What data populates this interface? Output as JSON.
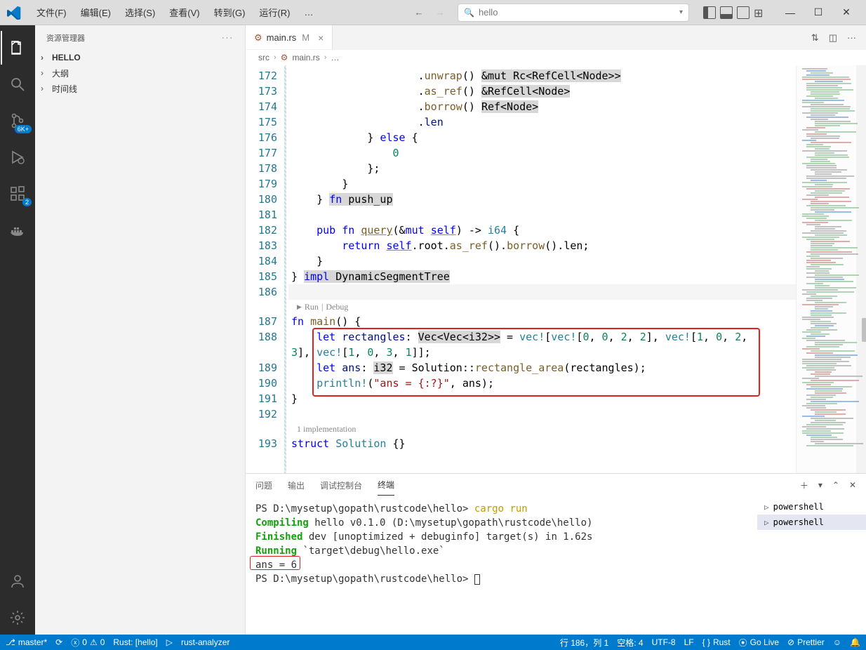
{
  "menus": {
    "file": "文件(F)",
    "edit": "编辑(E)",
    "select": "选择(S)",
    "view": "查看(V)",
    "goto": "转到(G)",
    "run": "运行(R)",
    "more": "…"
  },
  "search": {
    "text": "hello"
  },
  "activity": {
    "sc_badge": "6K+",
    "ext_badge": "2"
  },
  "explorer": {
    "title": "资源管理器",
    "items": [
      {
        "label": "HELLO",
        "bold": true
      },
      {
        "label": "大纲",
        "bold": false
      },
      {
        "label": "时间线",
        "bold": false
      }
    ]
  },
  "tab": {
    "name": "main.rs",
    "mod": "M"
  },
  "breadcrumb": {
    "folder": "src",
    "file": "main.rs",
    "rest": "…"
  },
  "lines": [
    172,
    173,
    174,
    175,
    176,
    177,
    178,
    179,
    180,
    181,
    182,
    183,
    184,
    185,
    186,
    187,
    188,
    189,
    190,
    191,
    192,
    193
  ],
  "code": {
    "l172": {
      "pre": "                    .",
      "fn": "unwrap",
      "suf": "() ",
      "hl": "&mut Rc<RefCell<Node>>"
    },
    "l173": {
      "pre": "                    .",
      "fn": "as_ref",
      "suf": "() ",
      "hl": "&RefCell<Node>"
    },
    "l174": {
      "pre": "                    .",
      "fn": "borrow",
      "suf": "() ",
      "hl": "Ref<Node>"
    },
    "l175": {
      "pre": "                    .",
      "var": "len"
    },
    "l176": {
      "pre": "            } ",
      "kw": "else",
      "suf": " {"
    },
    "l177": {
      "pre": "                ",
      "num": "0"
    },
    "l178": {
      "pre": "            };"
    },
    "l179": {
      "pre": "        }"
    },
    "l180": {
      "pre": "    } ",
      "kw": "fn",
      "hl": " push_up"
    },
    "l181": "",
    "l182": {
      "pre": "    ",
      "kw1": "pub",
      "sp": " ",
      "kw2": "fn",
      "sp2": " ",
      "name": "query",
      "open": "(&",
      "kw3": "mut",
      "sp3": " ",
      "self": "self",
      "close": ") -> ",
      "ty": "i64",
      "br": " {"
    },
    "l183": {
      "pre": "        ",
      "kw": "return",
      "sp": " ",
      "self": "self",
      "suf": ".root.",
      "fn1": "as_ref",
      "c1": "().",
      "fn2": "borrow",
      "c2": "().len;"
    },
    "l184": {
      "pre": "    }"
    },
    "l185": {
      "pre": "} ",
      "kw": "impl",
      "hl": " DynamicSegmentTree"
    },
    "l186": "",
    "codelens": {
      "run": "Run",
      "sep": "|",
      "debug": "Debug"
    },
    "l187": {
      "kw": "fn",
      "sp": " ",
      "fn": "main",
      "suf": "() {"
    },
    "l188": {
      "pre": "    ",
      "kw": "let",
      "sp": " ",
      "var": "rectangles",
      "colon": ": ",
      "hl": "Vec<Vec<i32>>",
      "eq": " = ",
      "mac1": "vec!",
      "b1": "[",
      "mac2": "vec!",
      "b2": "[",
      "n1": "0",
      "c1": ", ",
      "n2": "0",
      "c2": ", ",
      "n3": "2",
      "c3": ", ",
      "n4": "2",
      "b3": "], ",
      "mac3": "vec!",
      "b4": "[",
      "n5": "1",
      "c4": ", ",
      "n6": "0",
      "c5": ", ",
      "n7": "2",
      "c6": ","
    },
    "l188b": {
      "n1": "3",
      "b1": "], ",
      "mac": "vec!",
      "b2": "[",
      "n2": "1",
      "c1": ", ",
      "n3": "0",
      "c2": ", ",
      "n4": "3",
      "c3": ", ",
      "n5": "1",
      "b3": "]];"
    },
    "l189": {
      "pre": "    ",
      "kw": "let",
      "sp": " ",
      "var": "ans",
      "colon": ": ",
      "hl": "i32",
      "eq": " = Solution::",
      "fn": "rectangle_area",
      "suf": "(rectangles);"
    },
    "l190": {
      "pre": "    ",
      "mac": "println!",
      "open": "(",
      "str": "\"ans = {:?}\"",
      "suf": ", ans);"
    },
    "l191": "}",
    "l192": "",
    "impl_lens": "1 implementation",
    "l193": {
      "kw": "struct",
      "sp": " ",
      "name": "Solution",
      "suf": " {}"
    }
  },
  "panel": {
    "tabs": {
      "problems": "问题",
      "output": "输出",
      "debug": "调试控制台",
      "terminal": "终端"
    },
    "term": {
      "l1p": "PS D:\\mysetup\\gopath\\rustcode\\hello> ",
      "l1c": "cargo run",
      "l2a": "   Compiling",
      "l2b": " hello v0.1.0 (D:\\mysetup\\gopath\\rustcode\\hello)",
      "l3a": "    Finished",
      "l3b": " dev [unoptimized + debuginfo] target(s) in 1.62s",
      "l4a": "     Running",
      "l4b": " `target\\debug\\hello.exe`",
      "l5": "ans = 6",
      "l6": "PS D:\\mysetup\\gopath\\rustcode\\hello> "
    },
    "shells": [
      "powershell",
      "powershell"
    ]
  },
  "status": {
    "branch": "master*",
    "errors": "0",
    "warnings": "0",
    "rust": "Rust: [hello]",
    "ra": "rust-analyzer",
    "pos": "行 186，列 1",
    "spaces": "空格: 4",
    "enc": "UTF-8",
    "eol": "LF",
    "lang": "Rust",
    "golive": "Go Live",
    "prettier": "Prettier"
  }
}
